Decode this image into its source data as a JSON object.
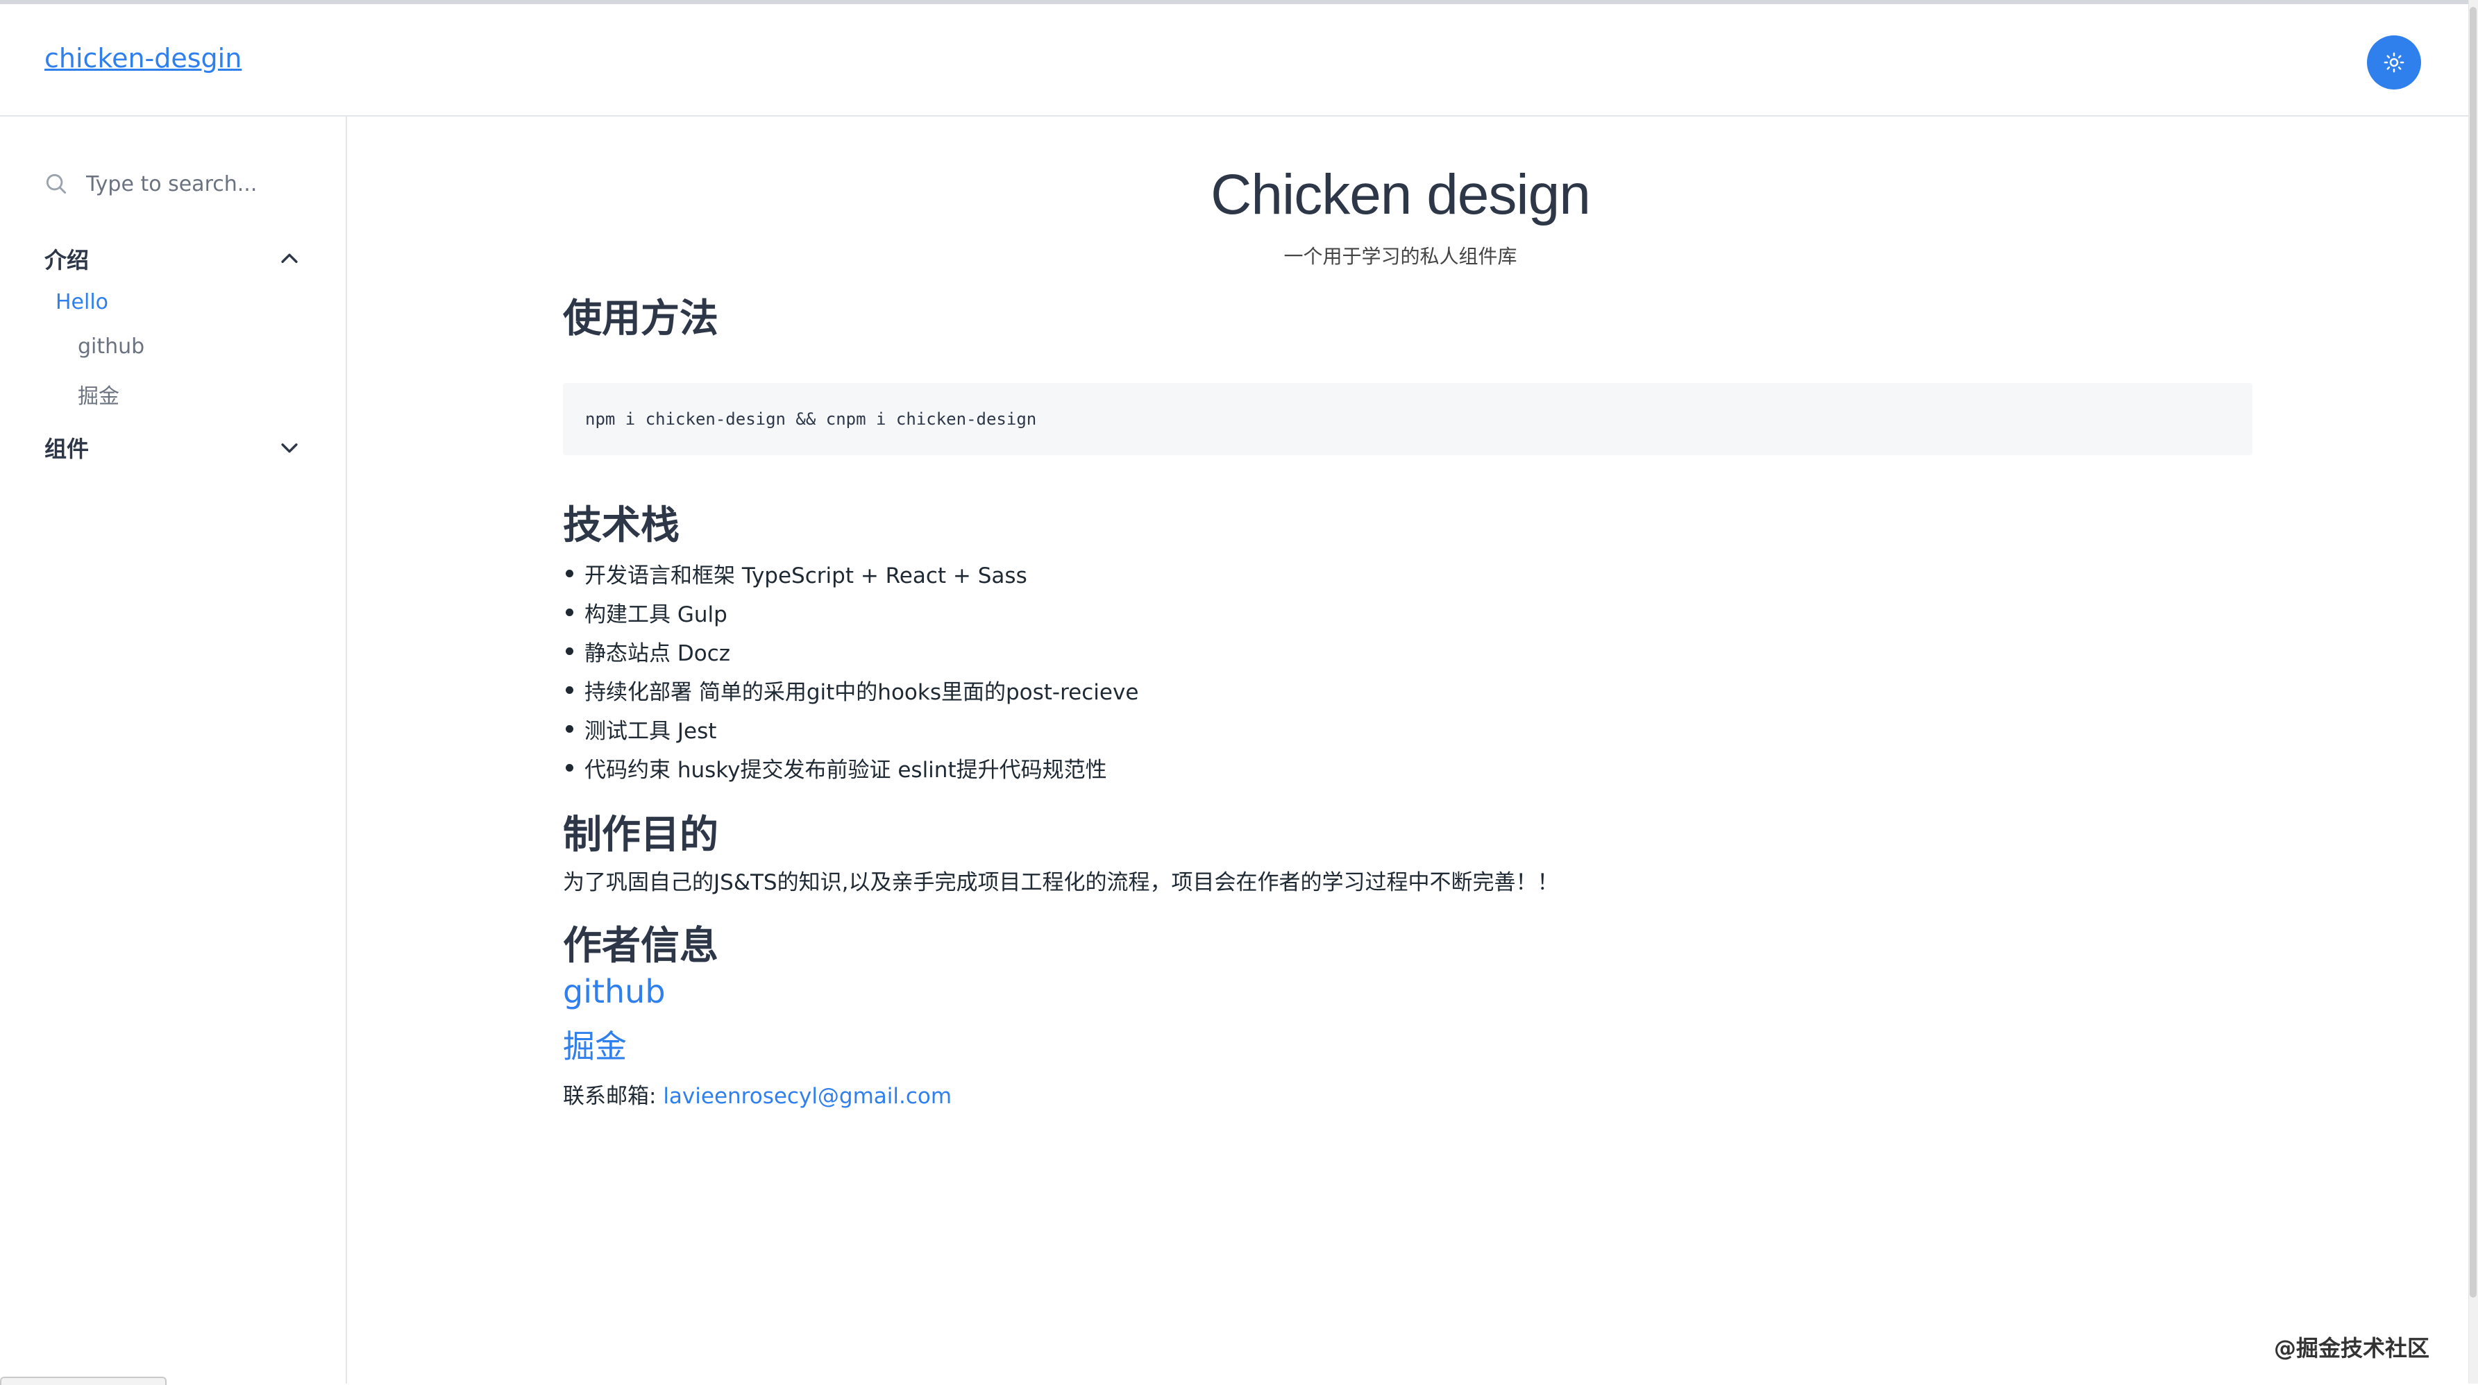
{
  "header": {
    "logo": "chicken-desgin",
    "theme_toggle_icon": "sun-icon"
  },
  "sidebar": {
    "search_placeholder": "Type to search...",
    "groups": [
      {
        "label": "介绍",
        "expanded": true,
        "items": [
          {
            "label": "Hello",
            "active": true
          },
          {
            "label": "github",
            "active": false
          },
          {
            "label": "掘金",
            "active": false
          }
        ]
      },
      {
        "label": "组件",
        "expanded": false,
        "items": []
      }
    ]
  },
  "main": {
    "title": "Chicken design",
    "subtitle": "一个用于学习的私人组件库",
    "usage": {
      "heading": "使用方法",
      "code": "npm i chicken-design && cnpm i chicken-design"
    },
    "stack": {
      "heading": "技术栈",
      "items": [
        "开发语言和框架 TypeScript + React + Sass",
        "构建工具 Gulp",
        "静态站点 Docz",
        "持续化部署 简单的采用git中的hooks里面的post-recieve",
        "测试工具 Jest",
        "代码约束 husky提交发布前验证 eslint提升代码规范性"
      ]
    },
    "purpose": {
      "heading": "制作目的",
      "text": "为了巩固自己的JS&TS的知识,以及亲手完成项目工程化的流程，项目会在作者的学习过程中不断完善！！"
    },
    "author": {
      "heading": "作者信息",
      "link_github": "github",
      "link_juejin": "掘金",
      "email_label": "联系邮箱: ",
      "email": "lavieenrosecyl@gmail.com"
    }
  },
  "watermark": "@掘金技术社区",
  "colors": {
    "accent": "#2f80ed",
    "text": "#2d3748",
    "code_bg": "#f5f7f9",
    "border": "#e2e6ea"
  }
}
